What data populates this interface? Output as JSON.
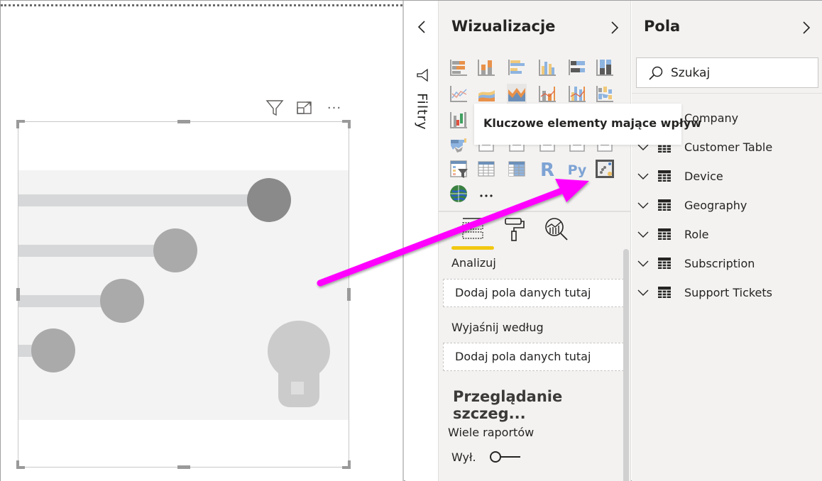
{
  "canvas": {
    "visual_header_icons": [
      "filter-icon",
      "focus-mode-icon",
      "more-options-icon"
    ],
    "more_options_glyph": "···",
    "placeholder_visual": "key-influencers-placeholder",
    "influencer_levels": [
      0.85,
      0.55,
      0.38,
      0.16
    ]
  },
  "filters": {
    "collapse_icon": "chevron-left-icon",
    "label": "Filtry"
  },
  "visualizations": {
    "title": "Wizualizacje",
    "expand_icon": "chevron-right-icon",
    "icons": [
      "stacked-bar-chart",
      "stacked-column-chart",
      "clustered-bar-chart",
      "clustered-column-chart",
      "100-stacked-bar-chart",
      "100-stacked-column-chart",
      "line-chart",
      "area-chart",
      "stacked-area-chart",
      "line-and-stacked-column-chart",
      "line-and-clustered-column-chart",
      "ribbon-chart",
      "waterfall-chart",
      "funnel-chart",
      "scatter-chart",
      "pie-chart",
      "donut-chart",
      "treemap",
      "filled-map",
      "funnel",
      "gauge",
      "card",
      "multi-row-card",
      "kpi",
      "slicer",
      "table",
      "matrix",
      "r-script-visual",
      "python-visual",
      "key-influencers",
      "arcgis-map",
      "more-visuals"
    ],
    "r_label": "R",
    "py_label": "Py",
    "more_label": "···",
    "tooltip": "Kluczowe elementy mające wpływ",
    "tabs": [
      "fields-tab",
      "format-tab",
      "analytics-tab"
    ],
    "active_tab": "fields-tab",
    "accent_color": "#f2c811",
    "wells": [
      {
        "label": "Analizuj",
        "placeholder": "Dodaj pola danych tutaj"
      },
      {
        "label": "Wyjaśnij według",
        "placeholder": "Dodaj pola danych tutaj"
      }
    ],
    "drillthrough": {
      "title": "Przeglądanie szczeg...",
      "cross_report_label": "Wiele raportów",
      "toggle_state": "Wył."
    }
  },
  "fields": {
    "title": "Pola",
    "expand_icon": "chevron-right-icon",
    "search_placeholder": "Szukaj",
    "tables": [
      "Company",
      "Customer Table",
      "Device",
      "Geography",
      "Role",
      "Subscription",
      "Support Tickets"
    ]
  },
  "annotation": {
    "arrow_color": "#ff00ff"
  }
}
